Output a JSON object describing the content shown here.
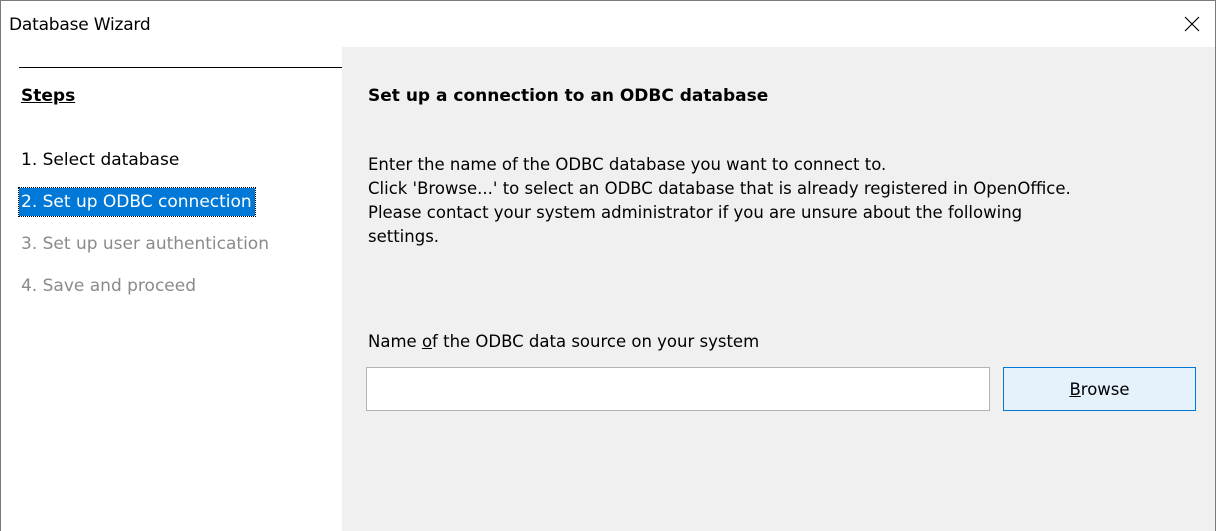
{
  "window": {
    "title": "Database Wizard",
    "close_icon": "close-icon"
  },
  "sidebar": {
    "heading": "Steps",
    "steps": [
      {
        "label": "1. Select database",
        "state": "done"
      },
      {
        "label": "2. Set up ODBC connection",
        "state": "active"
      },
      {
        "label": "3. Set up user authentication",
        "state": "pending"
      },
      {
        "label": "4. Save and proceed",
        "state": "pending"
      }
    ]
  },
  "main": {
    "heading": "Set up a connection to an ODBC database",
    "description_lines": [
      "Enter the name of the ODBC database you want to connect to.",
      "Click 'Browse...' to select an ODBC database that is already registered in OpenOffice.",
      "Please contact your system administrator if you are unsure about the following",
      "settings."
    ],
    "field_label_pre": "Name ",
    "field_label_accel": "o",
    "field_label_post": "f the ODBC data source on your system",
    "field_value": "",
    "browse_accel": "B",
    "browse_rest": "rowse"
  },
  "colors": {
    "selection": "#0078d7",
    "panel_bg": "#f0f0f0",
    "pending_text": "#8a8a8a",
    "button_bg": "#e5f1fb",
    "button_border": "#0078d7"
  }
}
